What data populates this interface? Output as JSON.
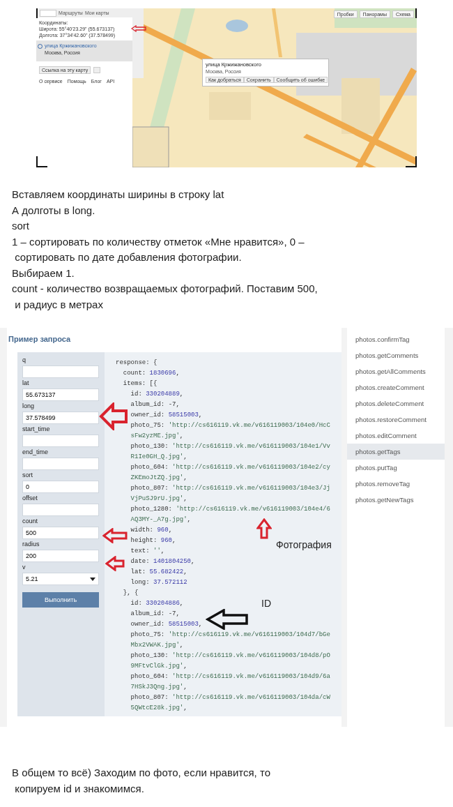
{
  "map_screenshot": {
    "tabs": [
      {
        "label": "Маршруты"
      },
      {
        "label": "Мои карты"
      }
    ],
    "coords_title": "Координаты:",
    "coords": [
      "Широта: 55°40'23.29\" (55.673137)",
      "Долгота: 37°34'42.60\" (37.578499)"
    ],
    "result": {
      "title": "улица Кржижановского",
      "subtitle": "Москва, Россия",
      "selected": true
    },
    "link_button": "Ссылка на эту карту",
    "footer_links": [
      "О сервисе",
      "Помощь",
      "Блог",
      "API"
    ],
    "map_buttons": [
      "Пробки",
      "Панорамы",
      "Схема"
    ],
    "popup": {
      "title": "улица Кржижановского",
      "subtitle": "Москва, Россия",
      "buttons": [
        "Как добраться",
        "Сохранить",
        "Сообщить об ошибке"
      ]
    },
    "map": {
      "kind": "picture"
    }
  },
  "intro_lines": [
    "Вставляем координаты ширины в строку lat",
    "А долготы в long.",
    "sort",
    "1 – сортировать по количеству отметок «Мне нравится», 0 –",
    " сортировать по дате добавления фотографии.",
    "Выбираем 1.",
    "count - количество возвращаемых фотографий. Поставим 500,",
    " и радиус в метрах"
  ],
  "api_example": {
    "title": "Пример запроса",
    "fields": [
      {
        "label": "q",
        "kind": "input"
      },
      {
        "label": "lat",
        "value": "55.673137",
        "kind": "input"
      },
      {
        "label": "long",
        "value": "37.578499",
        "kind": "input"
      },
      {
        "label": "start_time",
        "kind": "input"
      },
      {
        "label": "end_time",
        "kind": "input"
      },
      {
        "label": "sort",
        "value": "0",
        "kind": "input"
      },
      {
        "label": "offset",
        "kind": "input"
      },
      {
        "label": "count",
        "value": "500",
        "kind": "input"
      },
      {
        "label": "radius",
        "value": "200",
        "kind": "input"
      },
      {
        "label": "v",
        "value": "5.21",
        "kind": "select"
      }
    ],
    "run_button": "Выполнить",
    "code_lines": [
      {
        "key": "response: {"
      },
      {
        "key": "  count: ",
        "value": "1830696",
        "kind": "number",
        "tail": ","
      },
      {
        "key": "  items: [{"
      },
      {
        "key": "    id: ",
        "value": "330204889",
        "kind": "number",
        "tail": ","
      },
      {
        "key": "    album_id: ",
        "value": "-7",
        "kind": "plain",
        "tail": ","
      },
      {
        "key": "    owner_id: ",
        "value": "58515003",
        "kind": "number",
        "tail": ","
      },
      {
        "key": "    photo_75: ",
        "value": "'http://cs616119.vk.me/v616119003/104e0/HcC",
        "kind": "string"
      },
      {
        "value": "sFw2yzME.jpg'",
        "kind": "string",
        "tail": ","
      },
      {
        "key": "    photo_130: ",
        "value": "'http://cs616119.vk.me/v616119003/104e1/Vv",
        "kind": "string"
      },
      {
        "value": "R1Ie0GH_Q.jpg'",
        "kind": "string",
        "tail": ","
      },
      {
        "key": "    photo_604: ",
        "value": "'http://cs616119.vk.me/v616119003/104e2/cy",
        "kind": "string"
      },
      {
        "value": "ZKEmoJtZQ.jpg'",
        "kind": "string",
        "tail": ","
      },
      {
        "key": "    photo_807: ",
        "value": "'http://cs616119.vk.me/v616119003/104e3/Jj",
        "kind": "string"
      },
      {
        "value": "VjPuSJ9rU.jpg'",
        "kind": "string",
        "tail": ","
      },
      {
        "key": "    photo_1280: ",
        "value": "'http://cs616119.vk.me/v616119003/104e4/6",
        "kind": "string"
      },
      {
        "value": "AQ3MY-_A7g.jpg'",
        "kind": "string",
        "tail": ","
      },
      {
        "key": "    width: ",
        "value": "960",
        "kind": "number",
        "tail": ","
      },
      {
        "key": "    height: ",
        "value": "960",
        "kind": "number",
        "tail": ","
      },
      {
        "key": "    text: ",
        "value": "''",
        "kind": "string",
        "tail": ","
      },
      {
        "key": "    date: ",
        "value": "1401804250",
        "kind": "number",
        "tail": ","
      },
      {
        "key": "    lat: ",
        "value": "55.682422",
        "kind": "number",
        "tail": ","
      },
      {
        "key": "    long: ",
        "value": "37.572112",
        "kind": "number"
      },
      {
        "key": "  }, {"
      },
      {
        "key": "    id: ",
        "value": "330204886",
        "kind": "number",
        "tail": ","
      },
      {
        "key": "    album_id: ",
        "value": "-7",
        "kind": "plain",
        "tail": ","
      },
      {
        "key": "    owner_id: ",
        "value": "58515003",
        "kind": "number",
        "tail": ","
      },
      {
        "key": "    photo_75: ",
        "value": "'http://cs616119.vk.me/v616119003/104d7/bGe",
        "kind": "string"
      },
      {
        "value": "Mbx2VWAK.jpg'",
        "kind": "string",
        "tail": ","
      },
      {
        "key": "    photo_130: ",
        "value": "'http://cs616119.vk.me/v616119003/104d8/pO",
        "kind": "string"
      },
      {
        "value": "9MFtvClGk.jpg'",
        "kind": "string",
        "tail": ","
      },
      {
        "key": "    photo_604: ",
        "value": "'http://cs616119.vk.me/v616119003/104d9/6a",
        "kind": "string"
      },
      {
        "value": "7HSkJ3Qng.jpg'",
        "kind": "string",
        "tail": ","
      },
      {
        "key": "    photo_807: ",
        "value": "'http://cs616119.vk.me/v616119003/104da/cW",
        "kind": "string"
      },
      {
        "value": "5QWtcE28k.jpg'",
        "kind": "string",
        "tail": ","
      }
    ],
    "annotations": [
      {
        "label": "Фотография"
      },
      {
        "label": "ID"
      }
    ]
  },
  "methods": [
    {
      "label": "photos.confirmTag",
      "selected": false
    },
    {
      "label": "photos.getComments",
      "selected": false
    },
    {
      "label": "photos.getAllComments",
      "selected": false
    },
    {
      "label": "photos.createComment",
      "selected": false
    },
    {
      "label": "photos.deleteComment",
      "selected": false
    },
    {
      "label": "photos.restoreComment",
      "selected": false
    },
    {
      "label": "photos.editComment",
      "selected": false
    },
    {
      "label": "photos.getTags",
      "selected": true
    },
    {
      "label": "photos.putTag",
      "selected": false
    },
    {
      "label": "photos.removeTag",
      "selected": false
    },
    {
      "label": "photos.getNewTags",
      "selected": false
    }
  ],
  "outro_lines": [
    "В общем то всё) Заходим по фото, если нравится, то",
    " копируем id и знакомимся."
  ]
}
